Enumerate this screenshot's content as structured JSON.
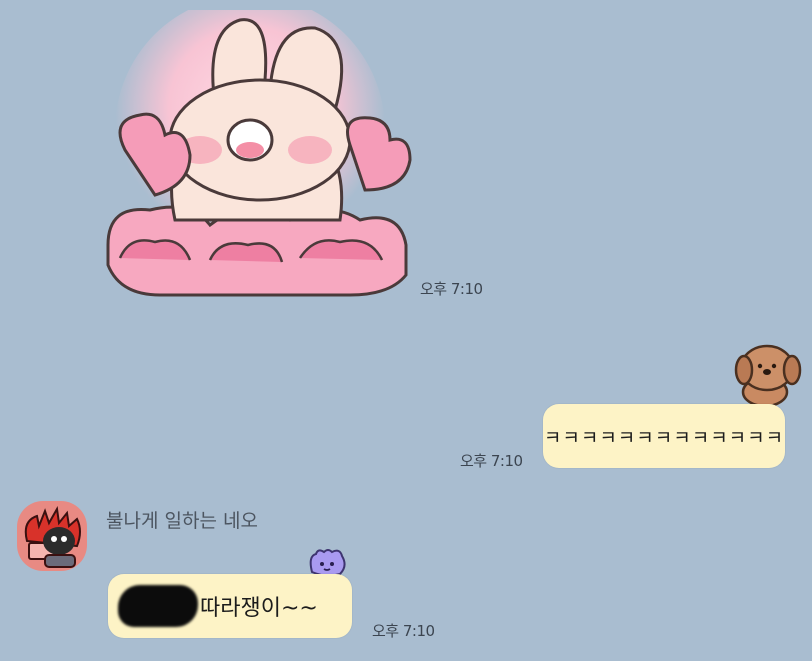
{
  "messages": [
    {
      "type": "sticker",
      "sticker": "bunny-hearts-sticker",
      "time": "오후 7:10"
    },
    {
      "type": "text",
      "direction": "outgoing",
      "text": "ㅋㅋㅋㅋㅋㅋㅋㅋㅋㅋㅋㅋㅋ",
      "time": "오후 7:10",
      "decoration": "brown-puppy-sticker"
    },
    {
      "type": "text",
      "direction": "incoming",
      "sender": "불나게 일하는 네오",
      "text": "따라쟁이~~",
      "redacted_prefix": true,
      "time": "오후 7:10",
      "decoration": "purple-blob-emoticon"
    }
  ],
  "colors": {
    "background": "#a9bdd0",
    "bubble": "#fdf3c6",
    "avatar_bg": "#e88a83"
  }
}
